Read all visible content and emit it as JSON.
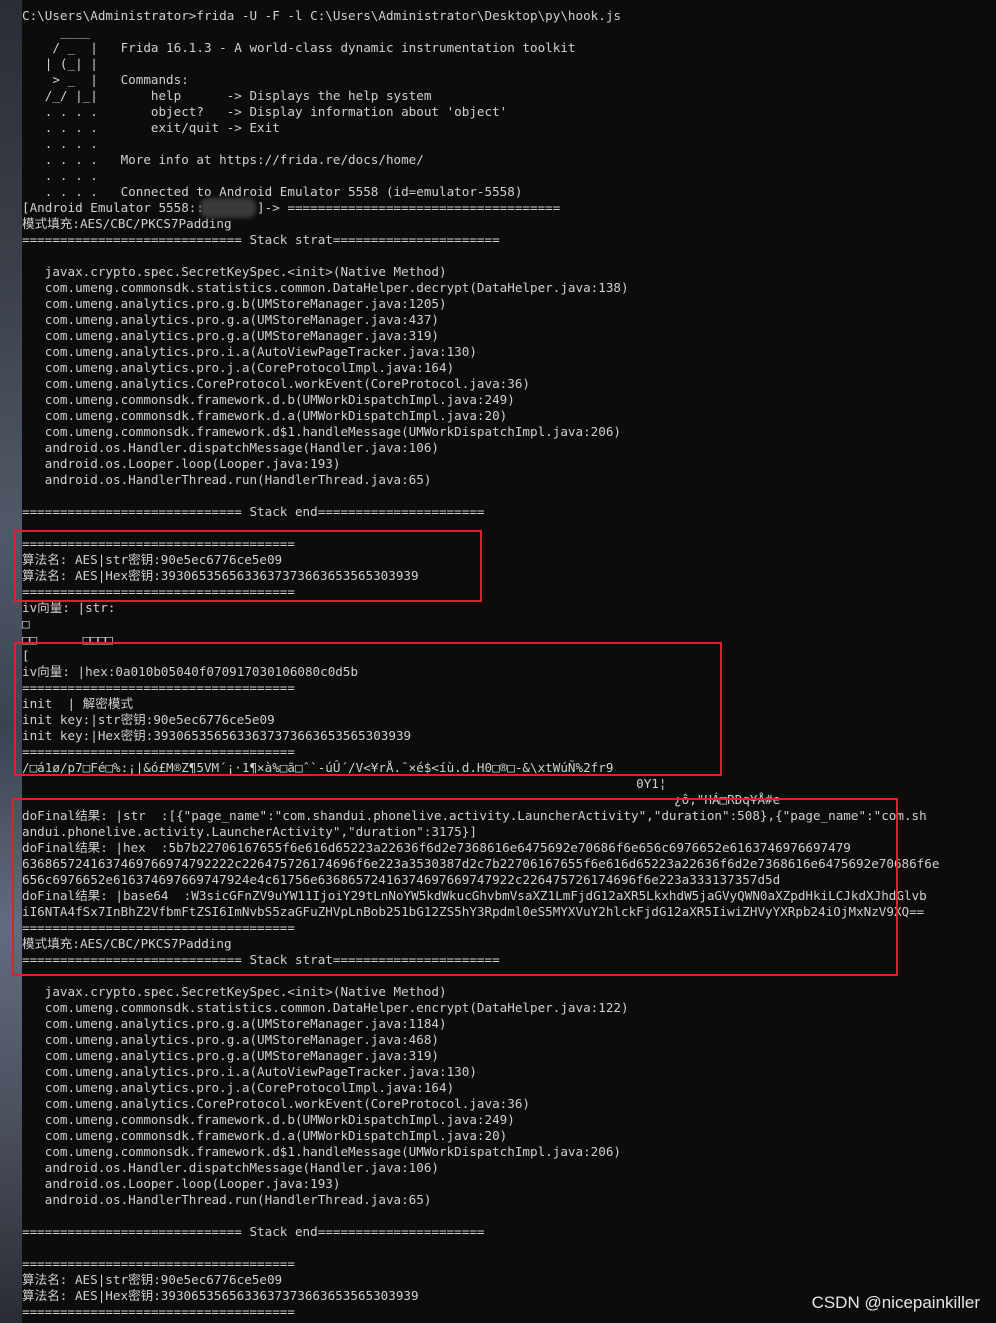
{
  "terminal": {
    "lines": [
      "C:\\Users\\Administrator>frida -U -F -l C:\\Users\\Administrator\\Desktop\\py\\hook.js",
      "     ____",
      "    / _  |   Frida 16.1.3 - A world-class dynamic instrumentation toolkit",
      "   | (_| |",
      "    > _  |   Commands:",
      "   /_/ |_|       help      -> Displays the help system",
      "   . . . .       object?   -> Display information about 'object'",
      "   . . . .       exit/quit -> Exit",
      "   . . . .",
      "   . . . .   More info at https://frida.re/docs/home/",
      "   . . . .",
      "   . . . .   Connected to Android Emulator 5558 (id=emulator-5558)",
      "[Android Emulator 5558::       ]-> ====================================",
      "模式填充:AES/CBC/PKCS7Padding",
      "============================= Stack strat======================",
      "",
      "   javax.crypto.spec.SecretKeySpec.<init>(Native Method)",
      "   com.umeng.commonsdk.statistics.common.DataHelper.decrypt(DataHelper.java:138)",
      "   com.umeng.analytics.pro.g.b(UMStoreManager.java:1205)",
      "   com.umeng.analytics.pro.g.a(UMStoreManager.java:437)",
      "   com.umeng.analytics.pro.g.a(UMStoreManager.java:319)",
      "   com.umeng.analytics.pro.i.a(AutoViewPageTracker.java:130)",
      "   com.umeng.analytics.pro.j.a(CoreProtocolImpl.java:164)",
      "   com.umeng.analytics.CoreProtocol.workEvent(CoreProtocol.java:36)",
      "   com.umeng.commonsdk.framework.d.b(UMWorkDispatchImpl.java:249)",
      "   com.umeng.commonsdk.framework.d.a(UMWorkDispatchImpl.java:20)",
      "   com.umeng.commonsdk.framework.d$1.handleMessage(UMWorkDispatchImpl.java:206)",
      "   android.os.Handler.dispatchMessage(Handler.java:106)",
      "   android.os.Looper.loop(Looper.java:193)",
      "   android.os.HandlerThread.run(HandlerThread.java:65)",
      "",
      "============================= Stack end======================",
      "",
      "====================================",
      "算法名: AES|str密钥:90e5ec6776ce5e09",
      "算法名: AES|Hex密钥:3930653565633637373663653565303939",
      "====================================",
      "iv向量: |str:",
      "□",
      "□□      □□□□",
      "[",
      "iv向量: |hex:0a010b05040f070917030106080c0d5b",
      "====================================",
      "init  | 解密模式",
      "init key:|str密钥:90e5ec6776ce5e09",
      "init key:|Hex密钥:3930653565633637373663653565303939",
      "====================================",
      "/□á1ø/p7□Fé□%:¡|&ó£M®Z¶5VM´¡·1¶×à%□ã□ˆ`-úÛ´/V<¥rÅ.¯×é$<íù.d.H0□®□-&\\xtWúÑ%2fr9",
      "                                                                                 0Y1¦",
      "                                                                                      ¿ô,\"HÁ□RDq¥Å#e",
      "doFinal结果: |str  :[{\"page_name\":\"com.shandui.phonelive.activity.LauncherActivity\",\"duration\":508},{\"page_name\":\"com.sh",
      "andui.phonelive.activity.LauncherActivity\",\"duration\":3175}]",
      "doFinal结果: |hex  :5b7b22706167655f6e616d65223a22636f6d2e7368616e6475692e70686f6e656c6976652e6163746976697479",
      "6368657241637469766974792222c226475726174696f6e223a3530387d2c7b22706167655f6e616d65223a22636f6d2e7368616e6475692e70686f6e",
      "656c6976652e616374697669747924e4c61756e63686572416374697669747922c226475726174696f6e223a333137357d5d",
      "doFinal结果: |base64  :W3sicGFnZV9uYW11IjoiY29tLnNoYW5kdWkucGhvbmVsaXZ1LmFjdG12aXR5LkxhdW5jaGVyQWN0aXZpdHkiLCJkdXJhdGlvb",
      "iI6NTA4fSx7InBhZ2VfbmFtZSI6ImNvbS5zaGFuZHVpLnBob251bG12ZS5hY3Rpdml0eS5MYXVuY2hlckFjdG12aXR5IiwiZHVyYXRpb24iOjMxNzV9XQ==",
      "====================================",
      "模式填充:AES/CBC/PKCS7Padding",
      "============================= Stack strat======================",
      "",
      "   javax.crypto.spec.SecretKeySpec.<init>(Native Method)",
      "   com.umeng.commonsdk.statistics.common.DataHelper.encrypt(DataHelper.java:122)",
      "   com.umeng.analytics.pro.g.a(UMStoreManager.java:1184)",
      "   com.umeng.analytics.pro.g.a(UMStoreManager.java:468)",
      "   com.umeng.analytics.pro.g.a(UMStoreManager.java:319)",
      "   com.umeng.analytics.pro.i.a(AutoViewPageTracker.java:130)",
      "   com.umeng.analytics.pro.j.a(CoreProtocolImpl.java:164)",
      "   com.umeng.analytics.CoreProtocol.workEvent(CoreProtocol.java:36)",
      "   com.umeng.commonsdk.framework.d.b(UMWorkDispatchImpl.java:249)",
      "   com.umeng.commonsdk.framework.d.a(UMWorkDispatchImpl.java:20)",
      "   com.umeng.commonsdk.framework.d$1.handleMessage(UMWorkDispatchImpl.java:206)",
      "   android.os.Handler.dispatchMessage(Handler.java:106)",
      "   android.os.Looper.loop(Looper.java:193)",
      "   android.os.HandlerThread.run(HandlerThread.java:65)",
      "",
      "============================= Stack end======================",
      "",
      "====================================",
      "算法名: AES|str密钥:90e5ec6776ce5e09",
      "算法名: AES|Hex密钥:3930653565633637373663653565303939",
      "===================================="
    ]
  },
  "watermark": "CSDN @nicepainkiller",
  "colors": {
    "background": "#0c0c0c",
    "text": "#d0d0d0",
    "highlight_border": "#e0202a"
  }
}
